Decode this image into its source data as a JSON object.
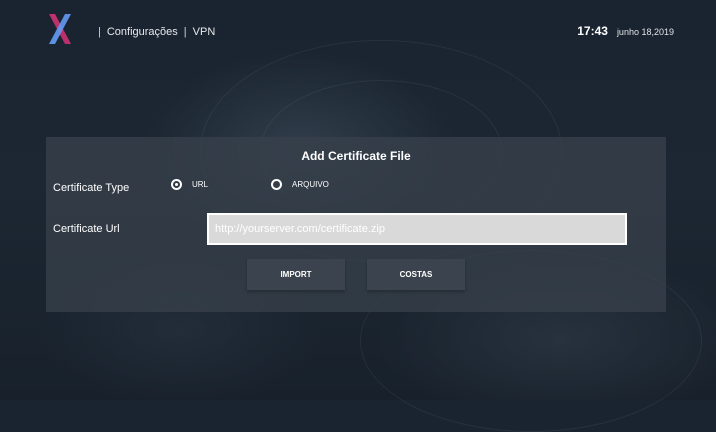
{
  "header": {
    "breadcrumb": [
      "Configurações",
      "VPN"
    ],
    "time": "17:43",
    "date": "junho 18,2019"
  },
  "dialog": {
    "title": "Add Certificate File",
    "certificate_type_label": "Certificate Type",
    "options": [
      {
        "label": "URL",
        "selected": true
      },
      {
        "label": "ARQUIVO",
        "selected": false
      }
    ],
    "certificate_url_label": "Certificate Url",
    "url_value": "http://yourserver.com/certificate.zip",
    "import_label": "IMPORT",
    "back_label": "COSTAS"
  },
  "colors": {
    "logo_gradient": [
      "#d9376e",
      "#5b8de6"
    ],
    "background": "#1c2733",
    "panel": "#37404a",
    "input_bg": "#d9d9d9"
  },
  "icons": [
    "x-logo-icon",
    "radio-selected-icon",
    "radio-unselected-icon"
  ]
}
